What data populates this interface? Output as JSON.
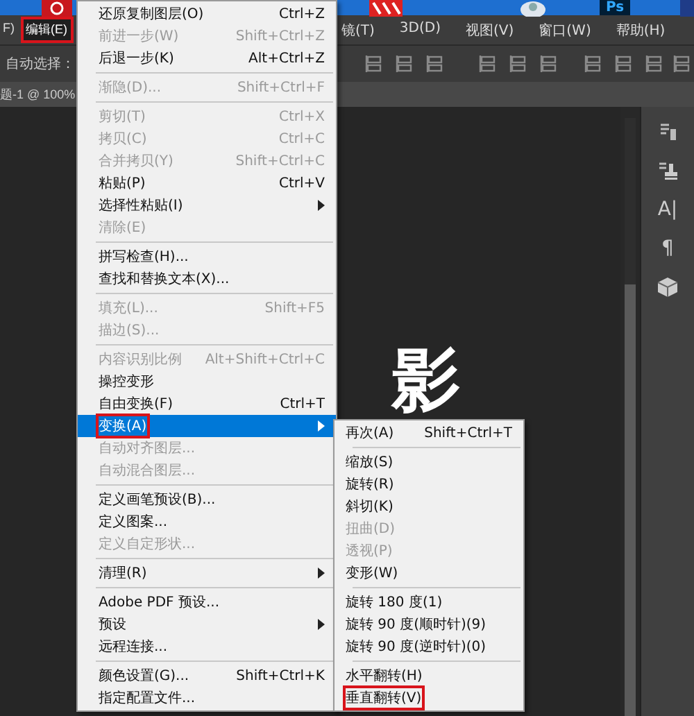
{
  "taskbar": {
    "app_label": "Ps"
  },
  "menubar": {
    "left": [
      {
        "label": "F)",
        "open": false,
        "annotated": false
      },
      {
        "label": "编辑(E)",
        "open": true,
        "annotated": true
      }
    ],
    "right": [
      {
        "label": "镜(T)",
        "open": false
      },
      {
        "label": "3D(D)",
        "open": false
      },
      {
        "label": "视图(V)",
        "open": false
      },
      {
        "label": "窗口(W)",
        "open": false
      },
      {
        "label": "帮助(H)",
        "open": false
      }
    ]
  },
  "options_bar": {
    "auto_select_label": "自动选择："
  },
  "document_tab": {
    "title": "题-1 @ 100%"
  },
  "canvas": {
    "text": "影"
  },
  "right_panel": {
    "character_icon": "A|",
    "paragraph_icon": "¶"
  },
  "edit_menu": {
    "items": [
      {
        "kind": "item",
        "label": "还原复制图层(O)",
        "shortcut": "Ctrl+Z",
        "disabled": false,
        "submenu": false,
        "selected": false,
        "annotated": false
      },
      {
        "kind": "item",
        "label": "前进一步(W)",
        "shortcut": "Shift+Ctrl+Z",
        "disabled": true,
        "submenu": false,
        "selected": false,
        "annotated": false
      },
      {
        "kind": "item",
        "label": "后退一步(K)",
        "shortcut": "Alt+Ctrl+Z",
        "disabled": false,
        "submenu": false,
        "selected": false,
        "annotated": false
      },
      {
        "kind": "separator"
      },
      {
        "kind": "item",
        "label": "渐隐(D)...",
        "shortcut": "Shift+Ctrl+F",
        "disabled": true,
        "submenu": false,
        "selected": false,
        "annotated": false
      },
      {
        "kind": "separator"
      },
      {
        "kind": "item",
        "label": "剪切(T)",
        "shortcut": "Ctrl+X",
        "disabled": true,
        "submenu": false,
        "selected": false,
        "annotated": false
      },
      {
        "kind": "item",
        "label": "拷贝(C)",
        "shortcut": "Ctrl+C",
        "disabled": true,
        "submenu": false,
        "selected": false,
        "annotated": false
      },
      {
        "kind": "item",
        "label": "合并拷贝(Y)",
        "shortcut": "Shift+Ctrl+C",
        "disabled": true,
        "submenu": false,
        "selected": false,
        "annotated": false
      },
      {
        "kind": "item",
        "label": "粘贴(P)",
        "shortcut": "Ctrl+V",
        "disabled": false,
        "submenu": false,
        "selected": false,
        "annotated": false
      },
      {
        "kind": "item",
        "label": "选择性粘贴(I)",
        "disabled": false,
        "submenu": true,
        "selected": false,
        "annotated": false
      },
      {
        "kind": "item",
        "label": "清除(E)",
        "disabled": true,
        "submenu": false,
        "selected": false,
        "annotated": false
      },
      {
        "kind": "separator"
      },
      {
        "kind": "item",
        "label": "拼写检查(H)...",
        "disabled": false,
        "submenu": false,
        "selected": false,
        "annotated": false
      },
      {
        "kind": "item",
        "label": "查找和替换文本(X)...",
        "disabled": false,
        "submenu": false,
        "selected": false,
        "annotated": false
      },
      {
        "kind": "separator"
      },
      {
        "kind": "item",
        "label": "填充(L)...",
        "shortcut": "Shift+F5",
        "disabled": true,
        "submenu": false,
        "selected": false,
        "annotated": false
      },
      {
        "kind": "item",
        "label": "描边(S)...",
        "disabled": true,
        "submenu": false,
        "selected": false,
        "annotated": false
      },
      {
        "kind": "separator"
      },
      {
        "kind": "item",
        "label": "内容识别比例",
        "shortcut": "Alt+Shift+Ctrl+C",
        "disabled": true,
        "submenu": false,
        "selected": false,
        "annotated": false
      },
      {
        "kind": "item",
        "label": "操控变形",
        "disabled": false,
        "submenu": false,
        "selected": false,
        "annotated": false
      },
      {
        "kind": "item",
        "label": "自由变换(F)",
        "shortcut": "Ctrl+T",
        "disabled": false,
        "submenu": false,
        "selected": false,
        "annotated": false
      },
      {
        "kind": "item",
        "label": "变换(A)",
        "disabled": false,
        "submenu": true,
        "selected": true,
        "annotated": true
      },
      {
        "kind": "item",
        "label": "自动对齐图层...",
        "disabled": true,
        "submenu": false,
        "selected": false,
        "annotated": false
      },
      {
        "kind": "item",
        "label": "自动混合图层...",
        "disabled": true,
        "submenu": false,
        "selected": false,
        "annotated": false
      },
      {
        "kind": "separator"
      },
      {
        "kind": "item",
        "label": "定义画笔预设(B)...",
        "disabled": false,
        "submenu": false,
        "selected": false,
        "annotated": false
      },
      {
        "kind": "item",
        "label": "定义图案...",
        "disabled": false,
        "submenu": false,
        "selected": false,
        "annotated": false
      },
      {
        "kind": "item",
        "label": "定义自定形状...",
        "disabled": true,
        "submenu": false,
        "selected": false,
        "annotated": false
      },
      {
        "kind": "separator"
      },
      {
        "kind": "item",
        "label": "清理(R)",
        "disabled": false,
        "submenu": true,
        "selected": false,
        "annotated": false
      },
      {
        "kind": "separator"
      },
      {
        "kind": "item",
        "label": "Adobe PDF 预设...",
        "disabled": false,
        "submenu": false,
        "selected": false,
        "annotated": false
      },
      {
        "kind": "item",
        "label": "预设",
        "disabled": false,
        "submenu": true,
        "selected": false,
        "annotated": false
      },
      {
        "kind": "item",
        "label": "远程连接...",
        "disabled": false,
        "submenu": false,
        "selected": false,
        "annotated": false
      },
      {
        "kind": "separator"
      },
      {
        "kind": "item",
        "label": "颜色设置(G)...",
        "shortcut": "Shift+Ctrl+K",
        "disabled": false,
        "submenu": false,
        "selected": false,
        "annotated": false
      },
      {
        "kind": "item",
        "label": "指定配置文件...",
        "disabled": false,
        "submenu": false,
        "selected": false,
        "annotated": false
      }
    ]
  },
  "transform_submenu": {
    "items": [
      {
        "kind": "item",
        "label": "再次(A)",
        "shortcut": "Shift+Ctrl+T",
        "disabled": false,
        "annotated": false
      },
      {
        "kind": "separator"
      },
      {
        "kind": "item",
        "label": "缩放(S)",
        "disabled": false,
        "annotated": false
      },
      {
        "kind": "item",
        "label": "旋转(R)",
        "disabled": false,
        "annotated": false
      },
      {
        "kind": "item",
        "label": "斜切(K)",
        "disabled": false,
        "annotated": false
      },
      {
        "kind": "item",
        "label": "扭曲(D)",
        "disabled": true,
        "annotated": false
      },
      {
        "kind": "item",
        "label": "透视(P)",
        "disabled": true,
        "annotated": false
      },
      {
        "kind": "item",
        "label": "变形(W)",
        "disabled": false,
        "annotated": false
      },
      {
        "kind": "separator"
      },
      {
        "kind": "item",
        "label": "旋转 180 度(1)",
        "disabled": false,
        "annotated": false
      },
      {
        "kind": "item",
        "label": "旋转 90 度(顺时针)(9)",
        "disabled": false,
        "annotated": false
      },
      {
        "kind": "item",
        "label": "旋转 90 度(逆时针)(0)",
        "disabled": false,
        "annotated": false
      },
      {
        "kind": "separator"
      },
      {
        "kind": "item",
        "label": "水平翻转(H)",
        "disabled": false,
        "annotated": false
      },
      {
        "kind": "item",
        "label": "垂直翻转(V)",
        "disabled": false,
        "annotated": true
      }
    ]
  }
}
